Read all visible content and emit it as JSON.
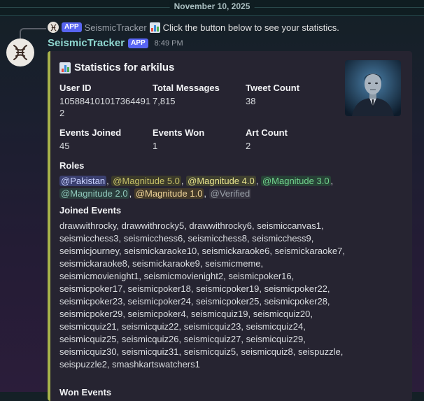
{
  "date_separator": "November 10, 2025",
  "reply": {
    "badge": "APP",
    "name": "SeismicTracker",
    "text": "Click the button below to see your statistics."
  },
  "message": {
    "username": "SeismicTracker",
    "badge": "APP",
    "time": "8:49 PM"
  },
  "embed": {
    "accent_color": "#a6b24a",
    "title": "Statistics for arkilus",
    "fields": [
      {
        "name": "User ID",
        "value": "1058841010173644912"
      },
      {
        "name": "Total Messages",
        "value": "7,815"
      },
      {
        "name": "Tweet Count",
        "value": "38"
      },
      {
        "name": "Events Joined",
        "value": "45"
      },
      {
        "name": "Events Won",
        "value": "1"
      },
      {
        "name": "Art Count",
        "value": "2"
      }
    ],
    "roles_title": "Roles",
    "roles": [
      {
        "label": "@Pakistan",
        "color": "#c9d2ff",
        "bg": "#3b4070"
      },
      {
        "label": "@Magnitude 5.0",
        "color": "#c8c26a",
        "bg": "#3b3a2a"
      },
      {
        "label": "@Magnitude 4.0",
        "color": "#e6e28c",
        "bg": "#3f4030"
      },
      {
        "label": "@Magnitude 3.0",
        "color": "#72d48e",
        "bg": "#274236"
      },
      {
        "label": "@Magnitude 2.0",
        "color": "#8fc7bb",
        "bg": "#2a3d3c"
      },
      {
        "label": "@Magnitude 1.0",
        "color": "#f0d59a",
        "bg": "#443a2a"
      },
      {
        "label": "@Verified",
        "color": "#9aa0a8",
        "bg": "#33313d"
      }
    ],
    "joined_title": "Joined Events",
    "joined_events": "drawwithrocky, drawwithrocky5, drawwithrocky6, seismiccanvas1, seismicchess3, seismicchess6, seismicchess8, seismicchess9, seismicjourney, seismickaraoke10, seismickaraoke6, seismickaraoke7, seismickaraoke8, seismickaraoke9, seismicmeme, seismicmovienight1, seismicmovienight2, seismicpoker16, seismicpoker17, seismicpoker18, seismicpoker19, seismicpoker22, seismicpoker23, seismicpoker24, seismicpoker25, seismicpoker28, seismicpoker29, seismicpoker4, seismicquiz19, seismicquiz20, seismicquiz21, seismicquiz22, seismicquiz23, seismicquiz24, seismicquiz25, seismicquiz26, seismicquiz27, seismicquiz29, seismicquiz30, seismicquiz31, seismicquiz5, seismicquiz8, seispuzzle, seispuzzle2, smashkartswatchers1",
    "next_title": "Won Events"
  }
}
